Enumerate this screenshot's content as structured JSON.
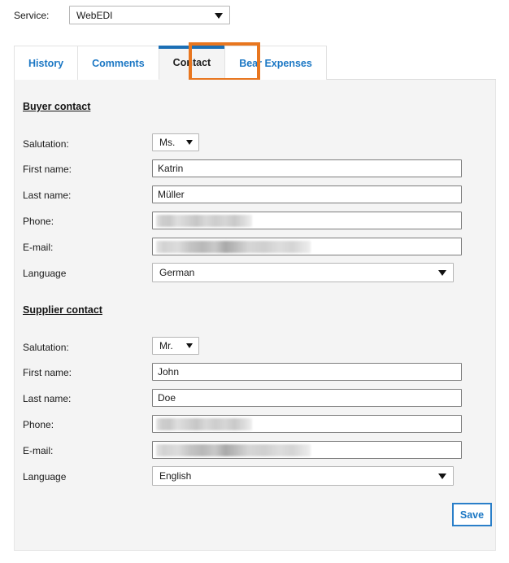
{
  "service": {
    "label": "Service:",
    "value": "WebEDI",
    "caret": "chevron-down-icon"
  },
  "tabs": [
    {
      "label": "History",
      "active": false
    },
    {
      "label": "Comments",
      "active": false
    },
    {
      "label": "Contact",
      "active": true
    },
    {
      "label": "Bear Expenses",
      "active": false
    }
  ],
  "highlight": {
    "target": "Contact",
    "color": "#e8761f"
  },
  "buyer": {
    "title": "Buyer contact",
    "salutation_label": "Salutation:",
    "salutation_value": "Ms.",
    "first_name_label": "First name:",
    "first_name_value": "Katrin",
    "last_name_label": "Last name:",
    "last_name_value": "Müller",
    "phone_label": "Phone:",
    "phone_value": "",
    "email_label": "E-mail:",
    "email_value": "",
    "language_label": "Language",
    "language_value": "German"
  },
  "supplier": {
    "title": "Supplier contact",
    "salutation_label": "Salutation:",
    "salutation_value": "Mr.",
    "first_name_label": "First name:",
    "first_name_value": "John",
    "last_name_label": "Last name:",
    "last_name_value": "Doe",
    "phone_label": "Phone:",
    "phone_value": "",
    "email_label": "E-mail:",
    "email_value": "",
    "language_label": "Language",
    "language_value": "English"
  },
  "actions": {
    "save_label": "Save"
  },
  "colors": {
    "tab_link": "#1b77c4",
    "active_tab_top": "#1b6fb5",
    "highlight": "#e8761f",
    "panel_bg": "#f4f4f4",
    "save_border": "#2a7fc9"
  }
}
